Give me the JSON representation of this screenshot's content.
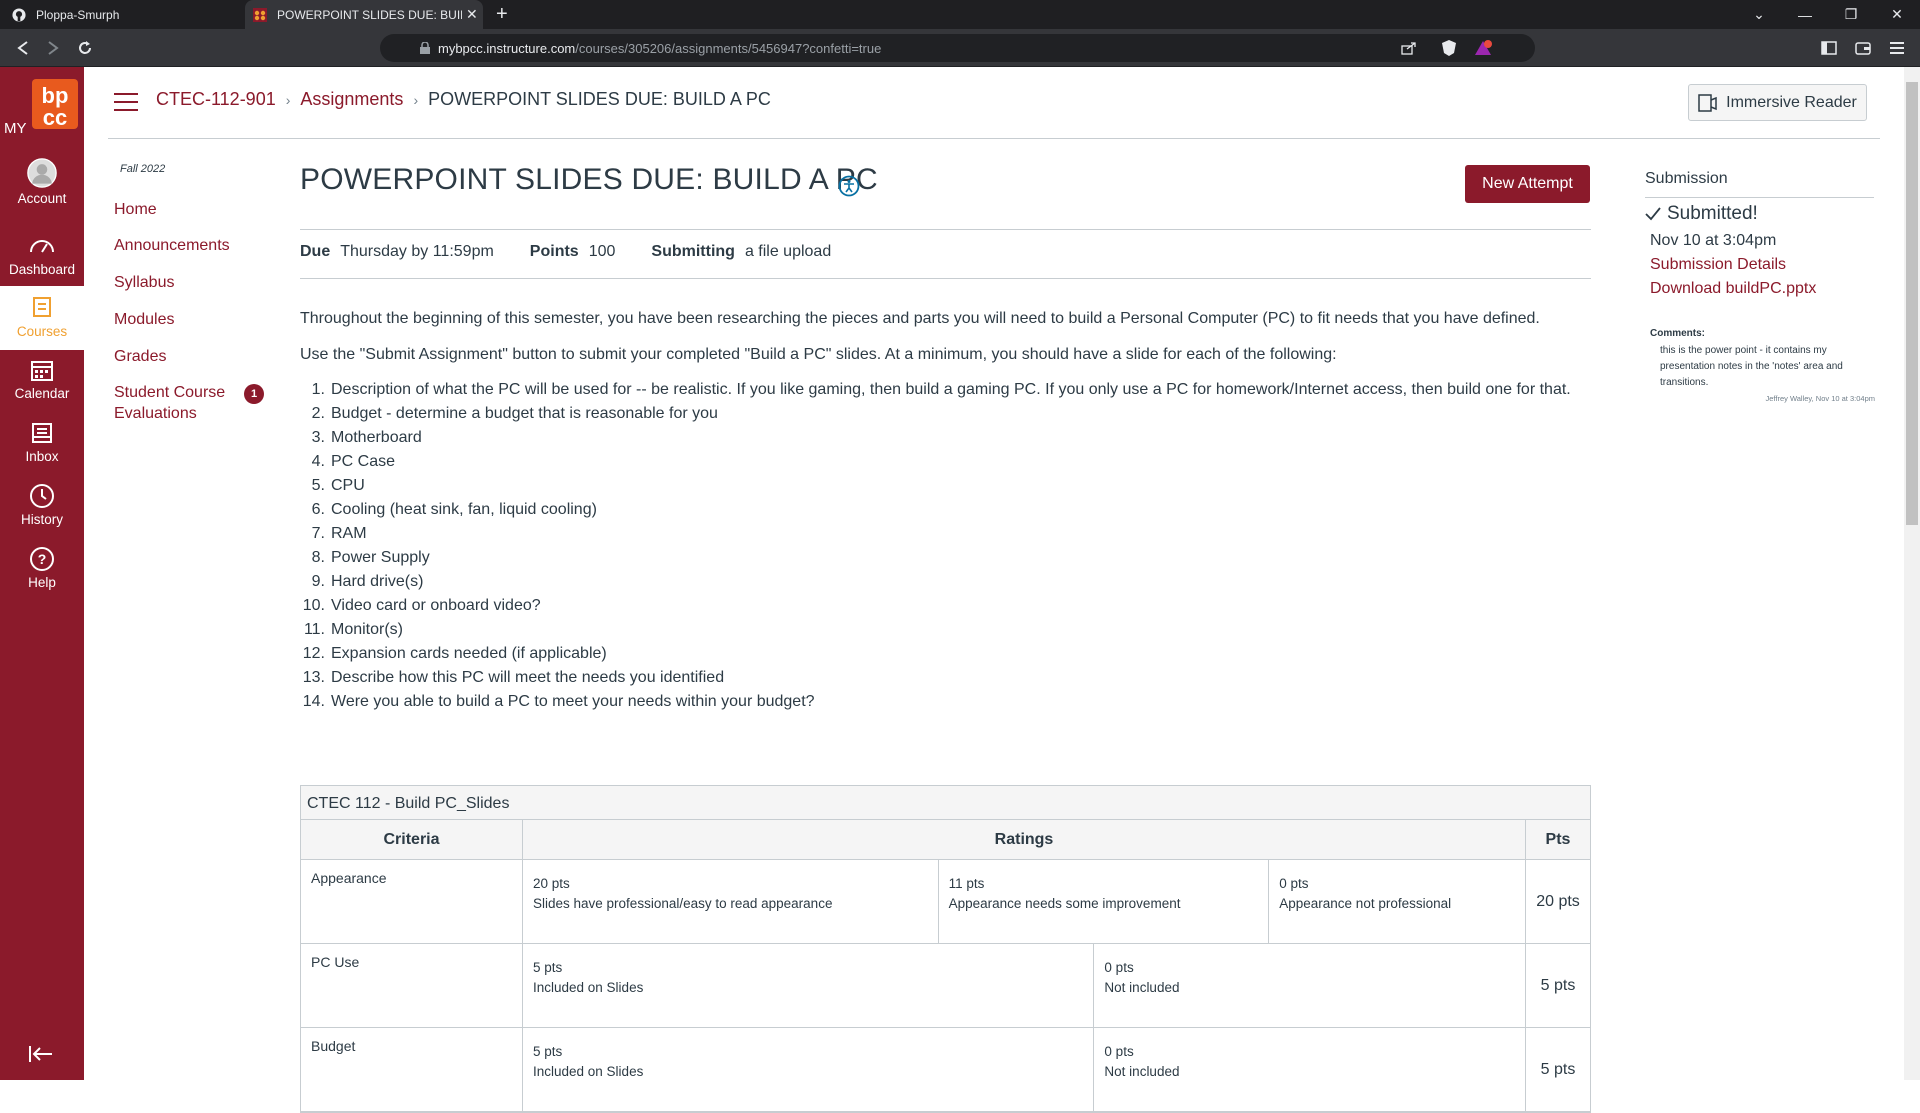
{
  "browser": {
    "tabs": [
      {
        "title": "Ploppa-Smurph",
        "active": false
      },
      {
        "title": "POWERPOINT SLIDES DUE: BUILD A PC",
        "active": true
      }
    ],
    "url_host": "mybpcc.instructure.com",
    "url_path": "/courses/305206/assignments/5456947?confetti=true"
  },
  "global_nav": {
    "logo_text": "MY bp cc",
    "items": [
      {
        "label": "Account",
        "icon": "account-icon"
      },
      {
        "label": "Dashboard",
        "icon": "dashboard-icon"
      },
      {
        "label": "Courses",
        "icon": "courses-icon",
        "active": true
      },
      {
        "label": "Calendar",
        "icon": "calendar-icon"
      },
      {
        "label": "Inbox",
        "icon": "inbox-icon"
      },
      {
        "label": "History",
        "icon": "history-icon"
      },
      {
        "label": "Help",
        "icon": "help-icon"
      }
    ]
  },
  "breadcrumb": {
    "course": "CTEC-112-901",
    "section": "Assignments",
    "current": "POWERPOINT SLIDES DUE: BUILD A PC"
  },
  "immersive_reader": "Immersive Reader",
  "course_nav": {
    "term": "Fall 2022",
    "items": [
      "Home",
      "Announcements",
      "Syllabus",
      "Modules",
      "Grades",
      "Student Course",
      "Evaluations"
    ],
    "evaluations_badge": "1"
  },
  "assignment": {
    "title": "POWERPOINT SLIDES DUE: BUILD A PC",
    "new_attempt": "New Attempt",
    "due_label": "Due",
    "due_value": "Thursday by 11:59pm",
    "points_label": "Points",
    "points_value": "100",
    "submitting_label": "Submitting",
    "submitting_value": "a file upload",
    "para1": "Throughout the beginning of this semester, you have been researching the pieces and parts you will need to build a Personal Computer (PC) to fit needs that you have defined.",
    "para2": "Use the \"Submit Assignment\" button to submit your completed \"Build a PC\" slides.  At a minimum, you should have a slide for each of the following:",
    "list": [
      "Description of what the PC will be used for -- be realistic.  If you like gaming, then build a gaming PC.  If you only use a PC for homework/Internet access, then build one for that.",
      "Budget - determine a budget that is reasonable for you",
      "Motherboard",
      "PC Case",
      "CPU",
      "Cooling (heat sink, fan, liquid cooling)",
      "RAM",
      "Power Supply",
      "Hard drive(s)",
      "Video card or onboard video?",
      "Monitor(s)",
      "Expansion cards needed (if applicable)",
      "Describe how this PC will meet the needs you identified",
      "Were you able to build a PC to meet your needs within your budget?"
    ]
  },
  "rubric": {
    "title": "CTEC 112 - Build PC_Slides",
    "headers": {
      "criteria": "Criteria",
      "ratings": "Ratings",
      "pts": "Pts"
    },
    "rows": [
      {
        "criterion": "Appearance",
        "ratings": [
          {
            "pts": "20 pts",
            "desc": "Slides have professional/easy to read appearance"
          },
          {
            "pts": "11 pts",
            "desc": "Appearance needs some improvement"
          },
          {
            "pts": "0 pts",
            "desc": "Appearance not professional"
          }
        ],
        "points": "20 pts"
      },
      {
        "criterion": "PC Use",
        "ratings": [
          {
            "pts": "5 pts",
            "desc": "Included on Slides"
          },
          {
            "pts": "0 pts",
            "desc": "Not included"
          }
        ],
        "points": "5 pts"
      },
      {
        "criterion": "Budget",
        "ratings": [
          {
            "pts": "5 pts",
            "desc": "Included on Slides"
          },
          {
            "pts": "0 pts",
            "desc": "Not included"
          }
        ],
        "points": "5 pts"
      }
    ]
  },
  "submission": {
    "heading": "Submission",
    "status": "Submitted!",
    "date": "Nov 10 at 3:04pm",
    "details_link": "Submission Details",
    "download_link": "Download buildPC.pptx",
    "comments_label": "Comments:",
    "comment": "this is the power point - it contains my presentation notes in the 'notes' area and transitions.",
    "comment_meta": "Jeffrey Walley, Nov 10 at 3:04pm"
  },
  "colors": {
    "brand": "#8b1a2b",
    "text": "#2d3b45",
    "border": "#c7cdd1"
  }
}
